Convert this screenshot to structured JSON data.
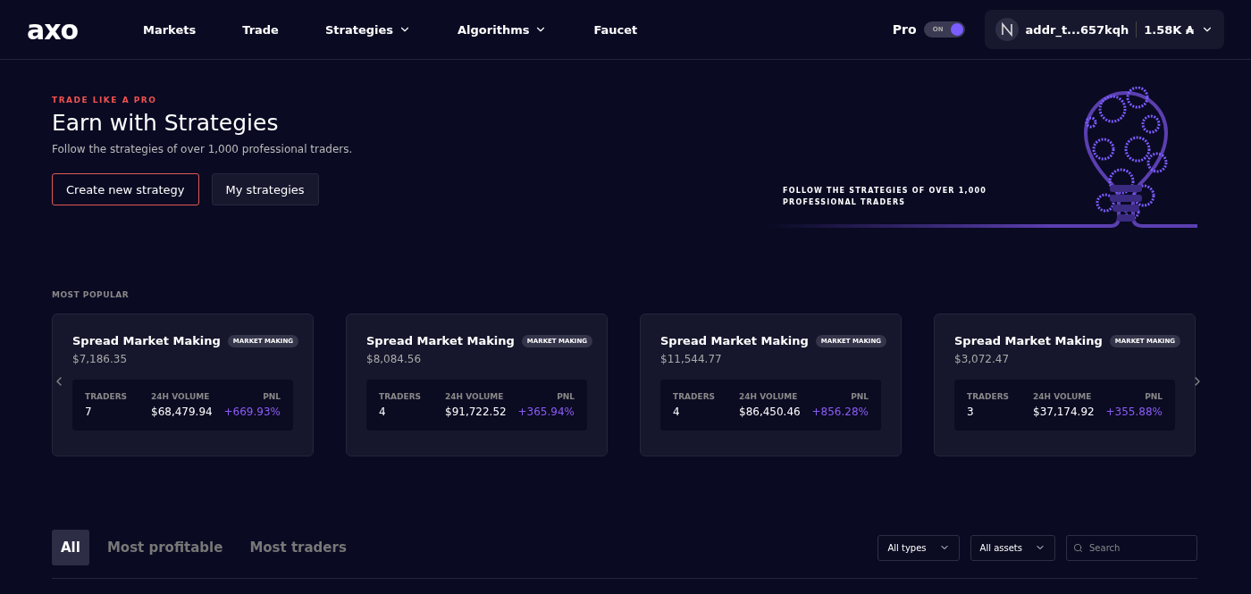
{
  "header": {
    "logo": "axo",
    "nav": [
      {
        "label": "Markets",
        "dropdown": false
      },
      {
        "label": "Trade",
        "dropdown": false
      },
      {
        "label": "Strategies",
        "dropdown": true
      },
      {
        "label": "Algorithms",
        "dropdown": true
      },
      {
        "label": "Faucet",
        "dropdown": false
      }
    ],
    "pro_toggle": {
      "label": "Pro",
      "state_label": "ON",
      "on": true
    },
    "wallet": {
      "address": "addr_t...657kqh",
      "balance": "1.58K ₳"
    }
  },
  "hero": {
    "kicker": "TRADE LIKE A PRO",
    "title": "Earn with Strategies",
    "subtitle": "Follow the strategies of over 1,000 professional traders.",
    "buttons": [
      {
        "label": "Create new strategy",
        "kind": "outlined"
      },
      {
        "label": "My strategies",
        "kind": "filled"
      }
    ],
    "banner_caption": "FOLLOW THE STRATEGIES OF OVER 1,000 PROFESSIONAL TRADERS"
  },
  "most_popular": {
    "heading": "MOST POPULAR",
    "cards": [
      {
        "name": "Spread Market Making",
        "tag": "MARKET MAKING",
        "value": "$7,186.35",
        "stats": [
          {
            "label": "TRADERS",
            "value": "7"
          },
          {
            "label": "24H VOLUME",
            "value": "$68,479.94"
          },
          {
            "label": "PNL",
            "value": "+669.93%"
          }
        ]
      },
      {
        "name": "Spread Market Making",
        "tag": "MARKET MAKING",
        "value": "$8,084.56",
        "stats": [
          {
            "label": "TRADERS",
            "value": "4"
          },
          {
            "label": "24H VOLUME",
            "value": "$91,722.52"
          },
          {
            "label": "PNL",
            "value": "+365.94%"
          }
        ]
      },
      {
        "name": "Spread Market Making",
        "tag": "MARKET MAKING",
        "value": "$11,544.77",
        "stats": [
          {
            "label": "TRADERS",
            "value": "4"
          },
          {
            "label": "24H VOLUME",
            "value": "$86,450.46"
          },
          {
            "label": "PNL",
            "value": "+856.28%"
          }
        ]
      },
      {
        "name": "Spread Market Making",
        "tag": "MARKET MAKING",
        "value": "$3,072.47",
        "stats": [
          {
            "label": "TRADERS",
            "value": "3"
          },
          {
            "label": "24H VOLUME",
            "value": "$37,174.92"
          },
          {
            "label": "PNL",
            "value": "+355.88%"
          }
        ]
      }
    ]
  },
  "filters": {
    "tabs": [
      {
        "label": "All",
        "selected": true
      },
      {
        "label": "Most profitable",
        "selected": false
      },
      {
        "label": "Most traders",
        "selected": false
      }
    ],
    "dropdowns": [
      "All types",
      "All assets"
    ],
    "search": {
      "placeholder": "Search"
    }
  }
}
